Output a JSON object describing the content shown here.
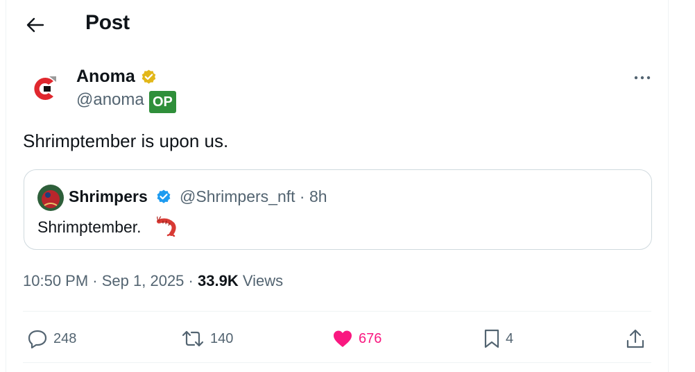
{
  "header": {
    "title": "Post",
    "back_icon": "arrow-left-icon"
  },
  "post": {
    "author": {
      "name": "Anoma",
      "handle": "@anoma",
      "badge": "OP",
      "verified": "gold",
      "avatar_icon": "anoma-logo",
      "avatar_colors": [
        "#e0282e",
        "#9a9a9a",
        "#111111"
      ]
    },
    "text": "Shrimptember is upon us.",
    "quote": {
      "name": "Shrimpers",
      "handle": "@Shrimpers_nft · 8h",
      "text": "Shrimptember.",
      "verified": "blue",
      "emoji_icon": "shrimp-icon"
    },
    "meta": {
      "time": "10:50 PM",
      "sep1": "·",
      "date": "Sep 1, 2025",
      "sep2": "·",
      "views_count": "33.9K",
      "views_label": "Views"
    },
    "actions": {
      "replies": "248",
      "reposts": "140",
      "likes": "676",
      "bookmarks": "4"
    }
  },
  "colors": {
    "text": "#0f1419",
    "muted": "#536471",
    "like": "#f91880",
    "verified_blue": "#1d9bf0",
    "verified_gold": "#e2b719",
    "op_badge": "#2f8f3a",
    "border": "#cfd9de"
  }
}
